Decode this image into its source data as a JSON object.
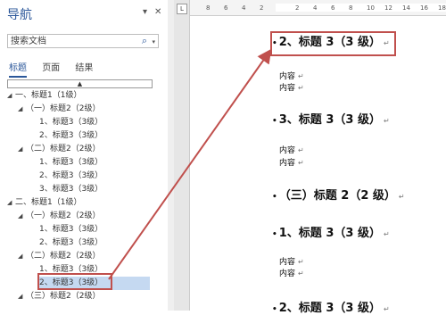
{
  "nav": {
    "title": "导航",
    "dropdown": "▾",
    "close": "✕",
    "search_placeholder": "搜索文档",
    "search_icon": "⌕",
    "tabs": [
      "标题",
      "页面",
      "结果"
    ],
    "collapse": "▲",
    "tree": [
      {
        "label": "一、标题1（1级）",
        "tri": "◢"
      },
      {
        "label": "（一）标题2（2级）",
        "tri": "◢"
      },
      {
        "label": "1、标题3（3级）",
        "tri": ""
      },
      {
        "label": "2、标题3（3级）",
        "tri": ""
      },
      {
        "label": "（二）标题2（2级）",
        "tri": "◢"
      },
      {
        "label": "1、标题3（3级）",
        "tri": ""
      },
      {
        "label": "2、标题3（3级）",
        "tri": ""
      },
      {
        "label": "3、标题3（3级）",
        "tri": ""
      },
      {
        "label": "二、标题1（1级）",
        "tri": "◢"
      },
      {
        "label": "（一）标题2（2级）",
        "tri": "◢"
      },
      {
        "label": "1、标题3（3级）",
        "tri": ""
      },
      {
        "label": "2、标题3（3级）",
        "tri": ""
      },
      {
        "label": "（二）标题2（2级）",
        "tri": "◢"
      },
      {
        "label": "1、标题3（3级）",
        "tri": ""
      },
      {
        "label": "2、标题3（3级）",
        "tri": ""
      },
      {
        "label": "（三）标题2（2级）",
        "tri": "◢"
      }
    ]
  },
  "ruler": {
    "button": "L",
    "ticks": [
      "8",
      "6",
      "4",
      "2",
      "",
      "2",
      "4",
      "6",
      "8",
      "10",
      "12",
      "14",
      "16",
      "18"
    ]
  },
  "document": {
    "lines": [
      {
        "text": "2、标题 3（3 级）",
        "kind": "heading"
      },
      {
        "text": "内容",
        "kind": "text"
      },
      {
        "text": "内容",
        "kind": "text"
      },
      {
        "text": "3、标题 3（3 级）",
        "kind": "heading"
      },
      {
        "text": "内容",
        "kind": "text"
      },
      {
        "text": "内容",
        "kind": "text"
      },
      {
        "text": "（三）标题 2（2 级）",
        "kind": "heading"
      },
      {
        "text": "1、标题 3（3 级）",
        "kind": "heading"
      },
      {
        "text": "内容",
        "kind": "text"
      },
      {
        "text": "内容",
        "kind": "text"
      },
      {
        "text": "2、标题 3（3 级）",
        "kind": "heading"
      }
    ],
    "para_mark": "↵",
    "bullet": "•"
  },
  "colors": {
    "accent": "#2b579a",
    "annotation": "#c0504d",
    "highlight": "#c5d9f1"
  }
}
